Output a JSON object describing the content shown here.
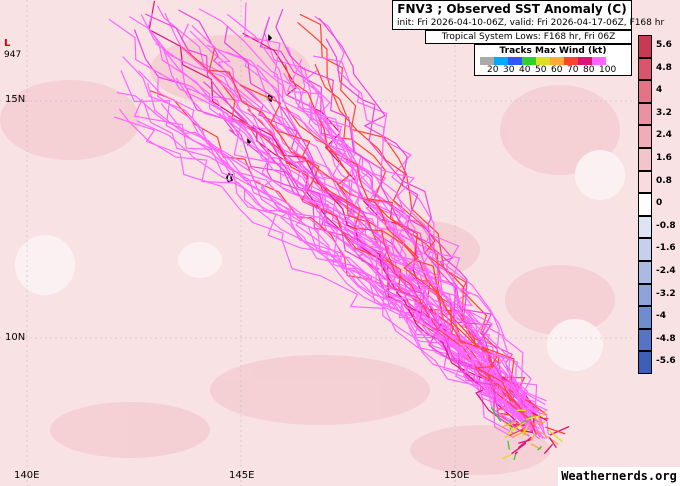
{
  "header": {
    "title": "FNV3 ; Observed SST Anomaly (C)",
    "subtitle": "init: Fri 2026-04-10-06Z, valid: Fri 2026-04-17-06Z, F168 hr",
    "lows_label": "Tropical System Lows: F168 hr, Fri 06Z"
  },
  "wind_legend": {
    "title": "Tracks Max Wind (kt)",
    "values": [
      "20",
      "30",
      "40",
      "50",
      "60",
      "70",
      "80",
      "100"
    ],
    "colors": [
      "#aaaaaa",
      "#00aaff",
      "#3355ff",
      "#33cc33",
      "#dddd22",
      "#ffaa33",
      "#ff4433",
      "#dd1177",
      "#ff66ff"
    ]
  },
  "colorbar": {
    "labels": [
      "5.6",
      "4.8",
      "4",
      "3.2",
      "2.4",
      "1.6",
      "0.8",
      "0",
      "-0.8",
      "-1.6",
      "-2.4",
      "-3.2",
      "-4",
      "-4.8",
      "-5.6"
    ],
    "colors": [
      "#c83a52",
      "#d8566c",
      "#e27486",
      "#ea92a1",
      "#f0adb8",
      "#f4c4cc",
      "#f8dadf",
      "#ffffff",
      "#dde4f4",
      "#c4d0ec",
      "#a9bbe3",
      "#8ca4d9",
      "#6f8cce",
      "#5575c4",
      "#3d5fb8"
    ]
  },
  "axes": {
    "lat_labels": [
      "15N",
      "10N"
    ],
    "lon_labels": [
      "140E",
      "145E",
      "150E"
    ]
  },
  "storm": {
    "marker": "L",
    "pressure": "947"
  },
  "branding": "Weathernerds.org"
}
